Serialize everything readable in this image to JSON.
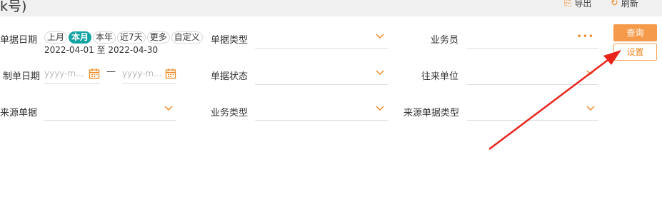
{
  "header": {
    "title": "k号)",
    "export_label": "导出",
    "refresh_label": "刷新"
  },
  "filters": {
    "doc_date_label": "单据日期",
    "quick_ranges": [
      "上月",
      "本月",
      "本年",
      "近7天",
      "更多",
      "自定义"
    ],
    "active_range": "本月",
    "date_range_text": "2022-04-01 至 2022-04-30",
    "doc_type_label": "单据类型",
    "salesperson_label": "业务员",
    "created_date_label": "制单日期",
    "created_start_placeholder": "yyyy-m...",
    "created_end_placeholder": "yyyy-m...",
    "date_separator": "—",
    "doc_status_label": "单据状态",
    "partner_label": "往来单位",
    "source_doc_label": "来源单据",
    "business_type_label": "业务类型",
    "source_doc_type_label": "来源单据类型"
  },
  "actions": {
    "query_label": "查询",
    "settings_label": "设置"
  },
  "colors": {
    "accent_orange": "#f08a24",
    "active_teal": "#14a3a3",
    "annotation_red": "#e8241c"
  }
}
